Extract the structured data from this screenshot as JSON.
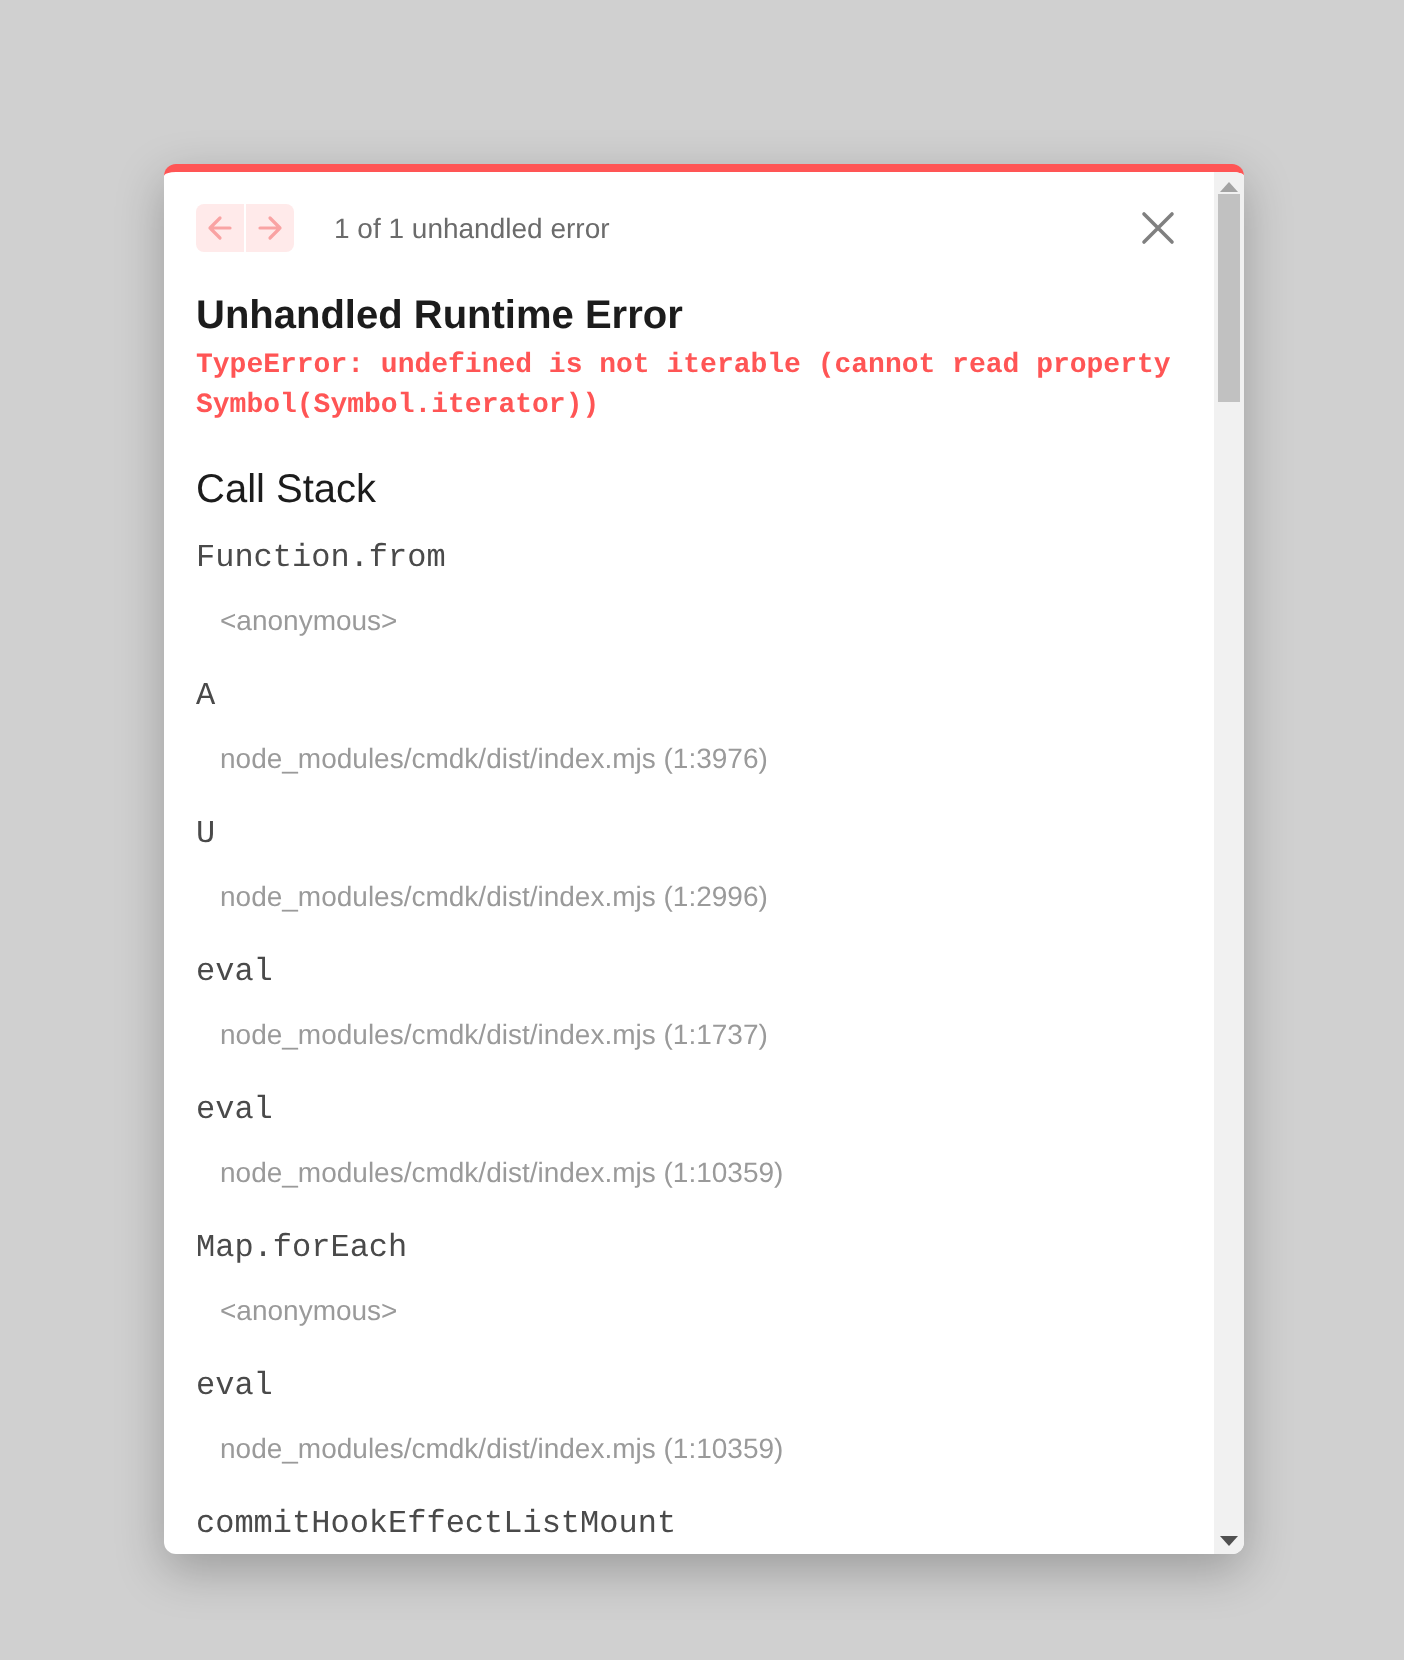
{
  "header": {
    "nav_buttons": [
      {
        "kind": "previous",
        "disabled": true
      },
      {
        "kind": "next",
        "disabled": true
      }
    ],
    "counter": "1 of 1 unhandled error"
  },
  "title": "Unhandled Runtime Error",
  "message": "TypeError: undefined is not iterable (cannot read property Symbol(Symbol.iterator))",
  "call_stack": {
    "heading": "Call Stack",
    "frames": [
      {
        "function": "Function.from",
        "location": "<anonymous>"
      },
      {
        "function": "A",
        "location": "node_modules/cmdk/dist/index.mjs (1:3976)"
      },
      {
        "function": "U",
        "location": "node_modules/cmdk/dist/index.mjs (1:2996)"
      },
      {
        "function": "eval",
        "location": "node_modules/cmdk/dist/index.mjs (1:1737)"
      },
      {
        "function": "eval",
        "location": "node_modules/cmdk/dist/index.mjs (1:10359)"
      },
      {
        "function": "Map.forEach",
        "location": "<anonymous>"
      },
      {
        "function": "eval",
        "location": "node_modules/cmdk/dist/index.mjs (1:10359)"
      },
      {
        "function": "commitHookEffectListMount"
      }
    ]
  }
}
